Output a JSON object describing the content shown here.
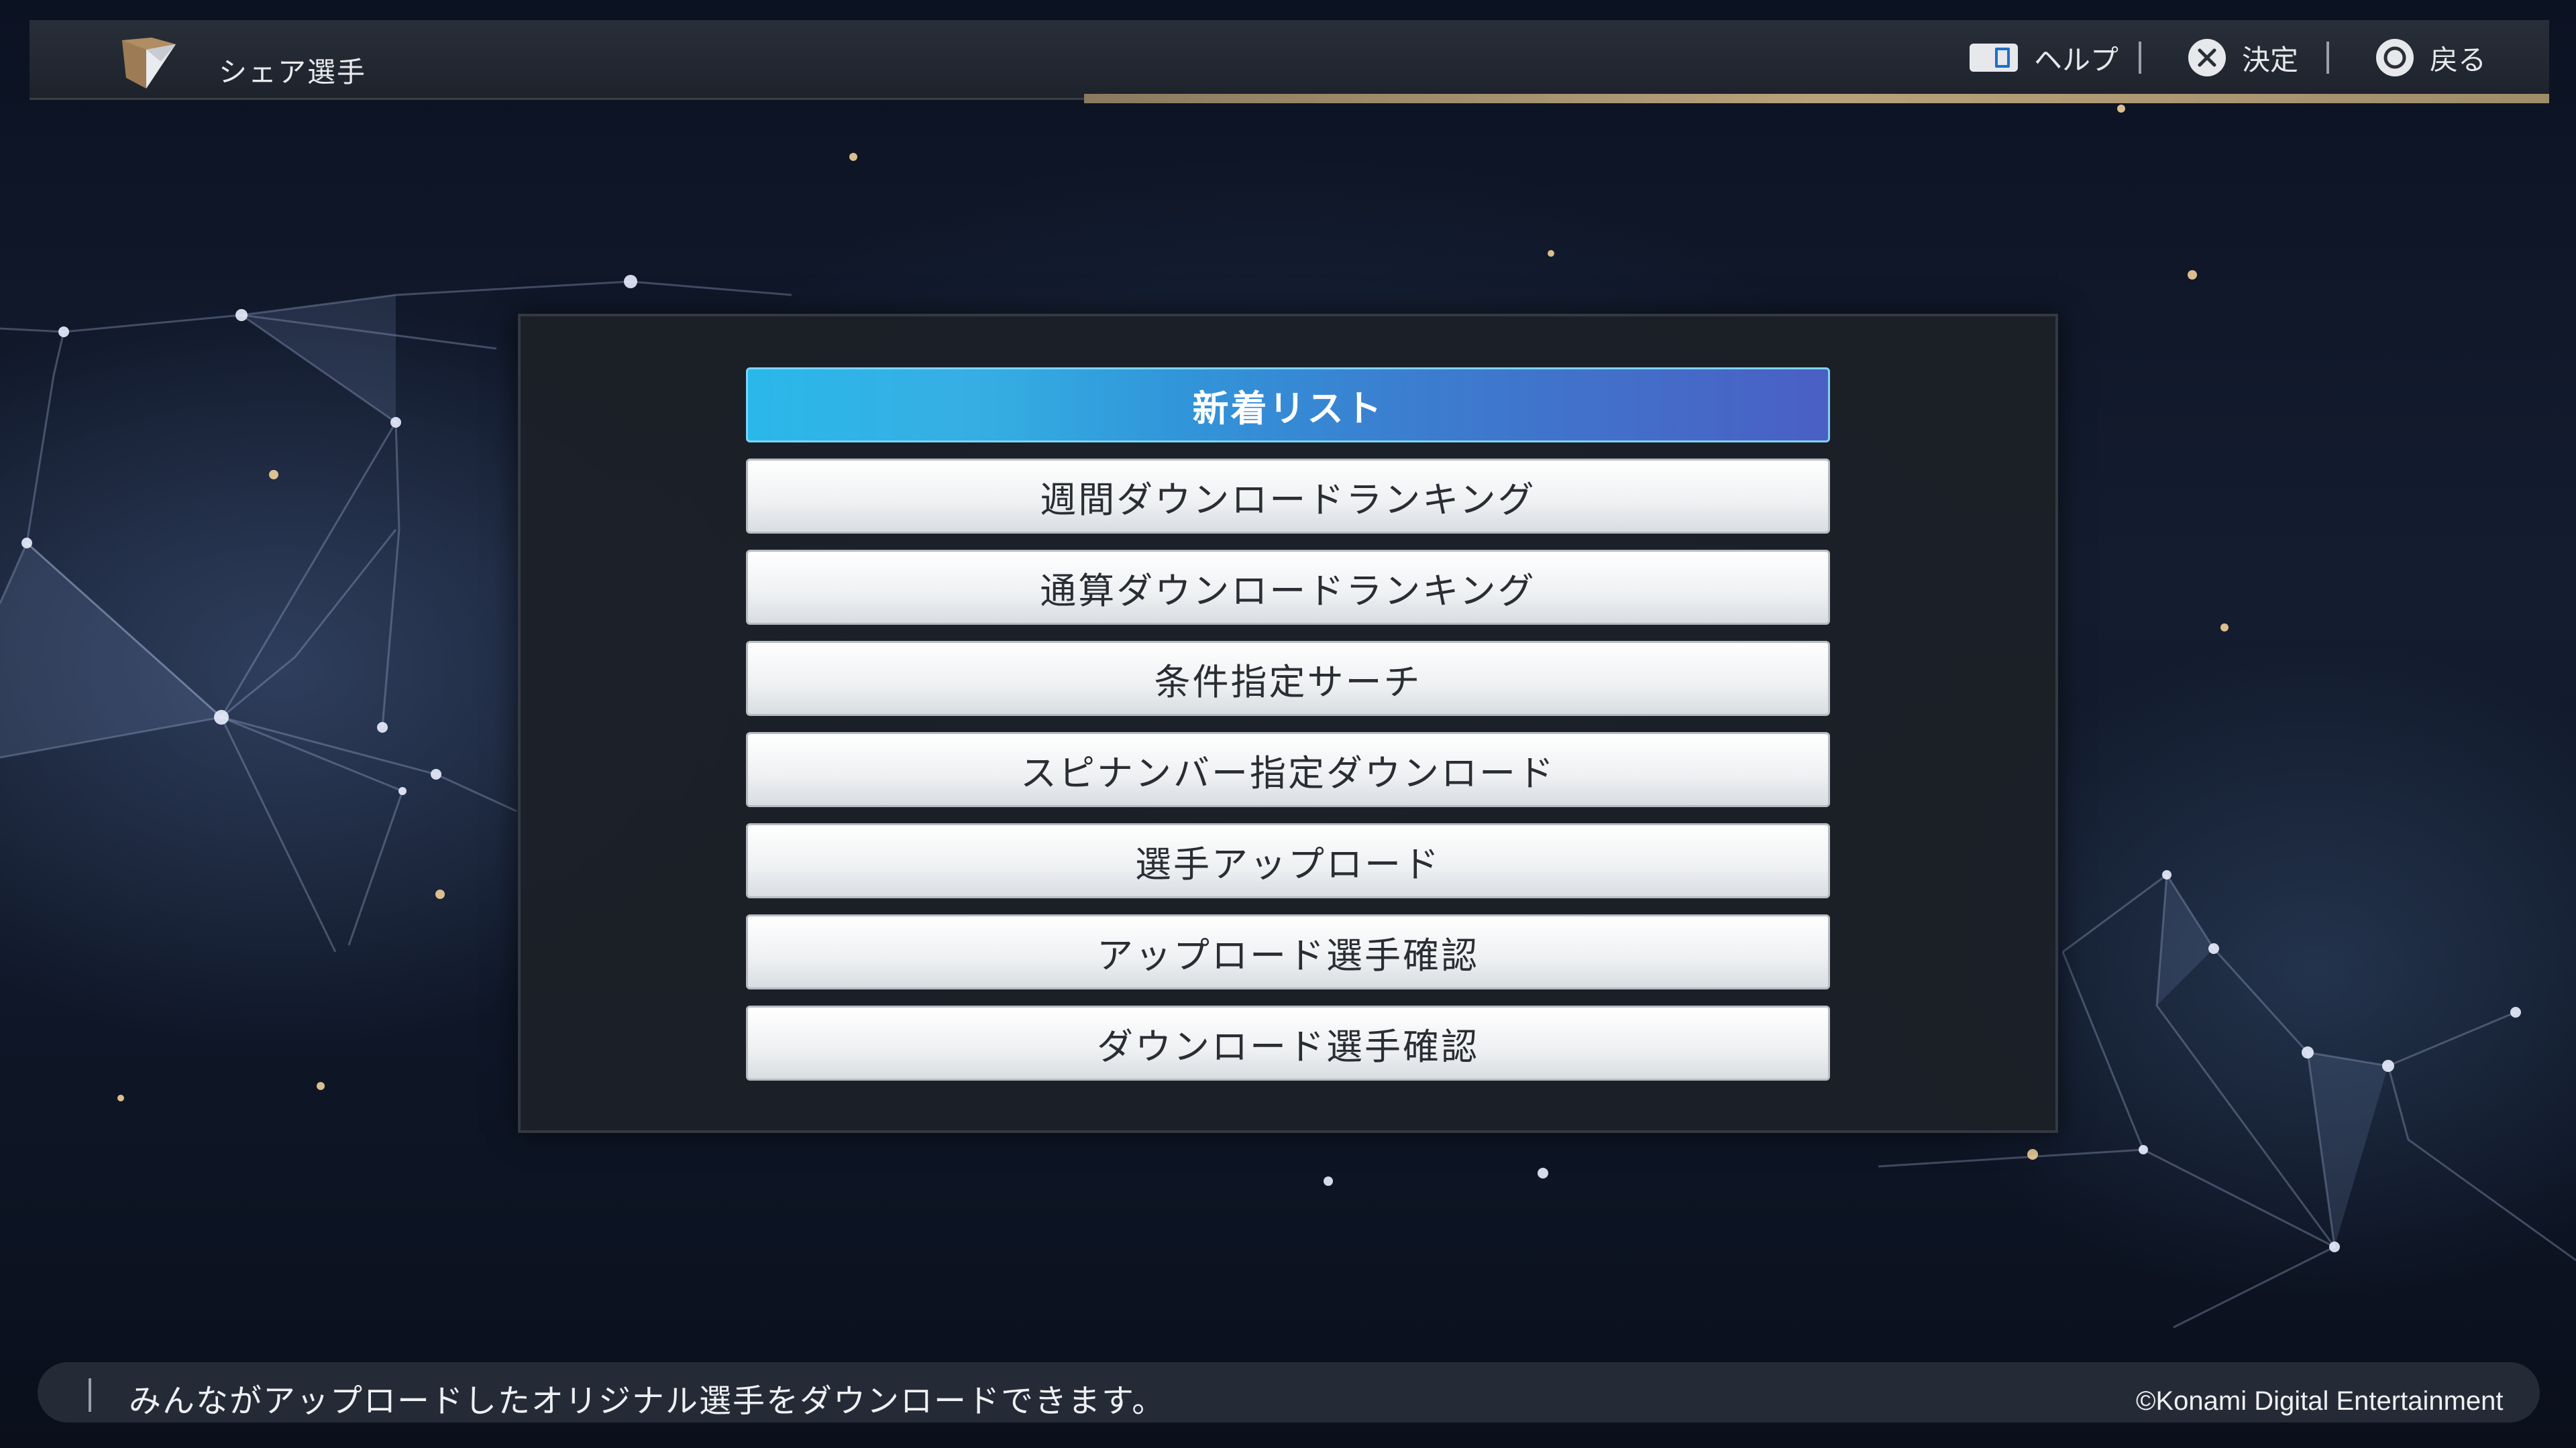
{
  "header": {
    "title": "シェア選手",
    "logo_icon": "emblem-icon",
    "hints": [
      {
        "icon": "touchpad-icon",
        "label": "ヘルプ"
      },
      {
        "icon": "cross-button-icon",
        "label": "決定"
      },
      {
        "icon": "circle-button-icon",
        "label": "戻る"
      }
    ]
  },
  "menu": {
    "items": [
      {
        "label": "新着リスト",
        "selected": true
      },
      {
        "label": "週間ダウンロードランキング",
        "selected": false
      },
      {
        "label": "通算ダウンロードランキング",
        "selected": false
      },
      {
        "label": "条件指定サーチ",
        "selected": false
      },
      {
        "label": "スピナンバー指定ダウンロード",
        "selected": false
      },
      {
        "label": "選手アップロード",
        "selected": false
      },
      {
        "label": "アップロード選手確認",
        "selected": false
      },
      {
        "label": "ダウンロード選手確認",
        "selected": false
      }
    ]
  },
  "footer": {
    "description": "みんながアップロードしたオリジナル選手をダウンロードできます。",
    "copyright": "©Konami Digital Entertainment"
  },
  "colors": {
    "accent_blue": "#2ab8ea",
    "accent_gold": "#b8a27b",
    "panel": "#1c2028"
  }
}
